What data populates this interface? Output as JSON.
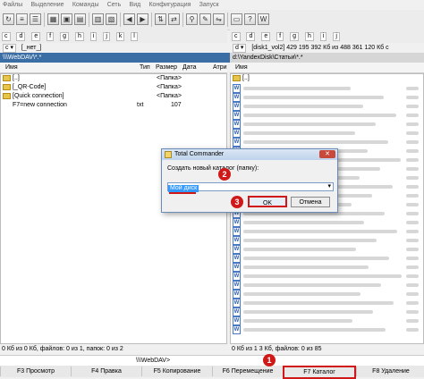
{
  "menu": [
    "Файлы",
    "Выделение",
    "Команды",
    "Сеть",
    "Вид",
    "Конфигурация",
    "Запуск"
  ],
  "left": {
    "drive_label": "c",
    "drive_info": "[_нет_]",
    "path": "\\\\\\WebDAV\\*.*",
    "columns": {
      "name": "Имя",
      "type": "Тип",
      "size": "Размер",
      "date": "Дата",
      "attr": "Атри"
    },
    "rows": [
      {
        "name": "[..]",
        "type": "",
        "size": "<Папка>"
      },
      {
        "name": "[_QR-Code]",
        "type": "",
        "size": "<Папка>"
      },
      {
        "name": "[Quick connection]",
        "type": "",
        "size": "<Папка>"
      },
      {
        "name": "F7=new connection",
        "type": "txt",
        "size": "107"
      }
    ],
    "status": "0 Кб из 0 Кб, файлов: 0 из 1, папок: 0 из 2",
    "cmd_path": "\\\\\\WebDAV>"
  },
  "right": {
    "drive_label": "d",
    "drive_info": "[disk1_vol2]  429 195 392 Кб из 488 361 120 Кб с",
    "path": "d:\\YandexDisk\\Статьи\\*.*",
    "first_row": "[..]",
    "status": "0 Кб из 1 3 Кб, файлов: 0 из 85"
  },
  "dialog": {
    "title": "Total Commander",
    "prompt": "Создать новый каталог (папку):",
    "input_value": "Мой диск",
    "ok": "OK",
    "cancel": "Отмена",
    "close": "✕"
  },
  "fkeys": [
    "F3 Просмотр",
    "F4 Правка",
    "F5 Копирование",
    "F6 Перемещение",
    "F7 Каталог",
    "F8 Удаление"
  ],
  "badges": [
    "1",
    "2",
    "3"
  ],
  "accent_red": "#d01818"
}
